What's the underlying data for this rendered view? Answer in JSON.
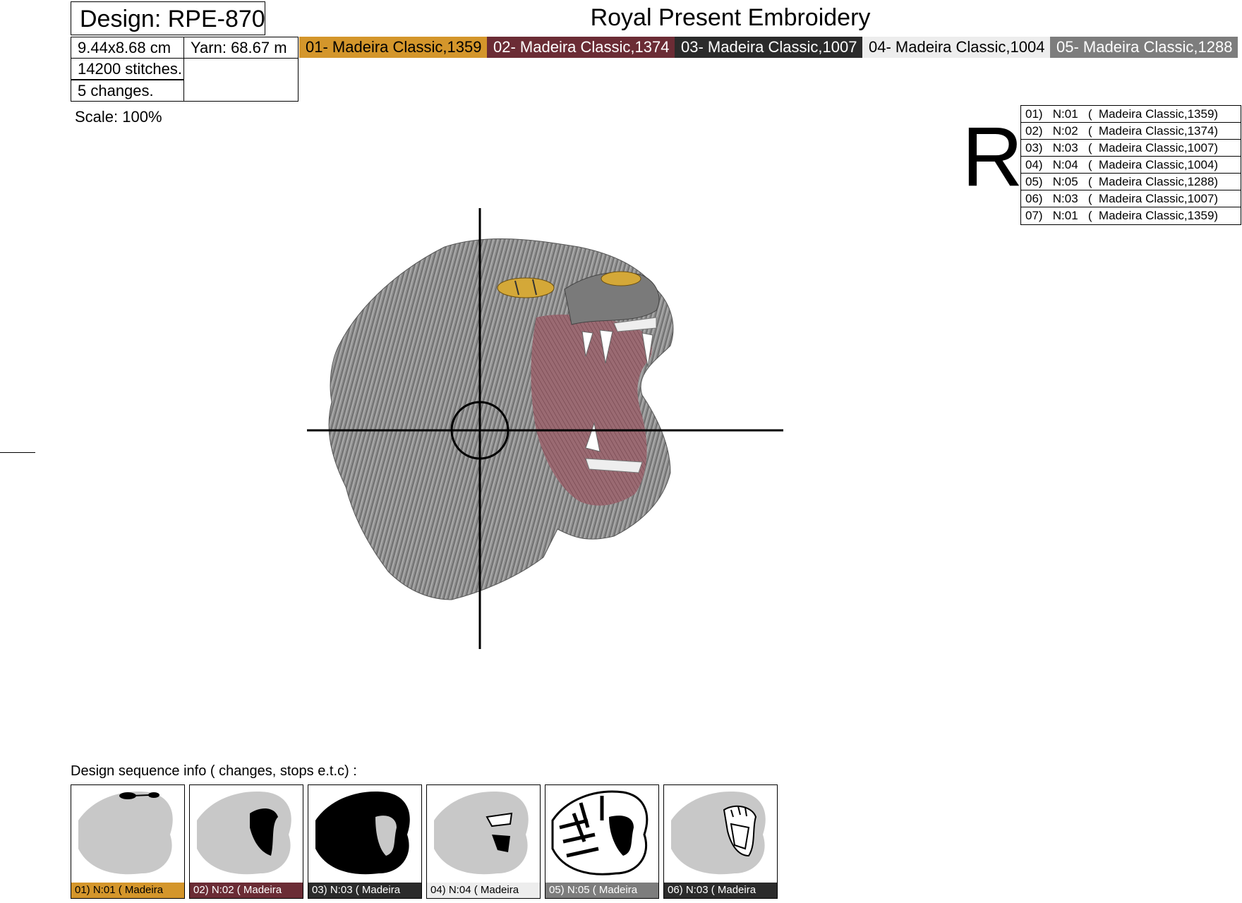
{
  "header": {
    "design_label": "Design: RPE-870",
    "company": "Royal Present Embroidery"
  },
  "stats": {
    "size": "9.44x8.68 cm",
    "yarn": "Yarn: 68.67 m",
    "stitches": "14200 stitches.",
    "changes": "5 changes."
  },
  "threads": [
    {
      "label": "01- Madeira Classic,1359",
      "color": "#d4962b",
      "text_color": "#000000"
    },
    {
      "label": "02- Madeira Classic,1374",
      "color": "#6b2c35",
      "text_color": "#ffffff"
    },
    {
      "label": "03- Madeira Classic,1007",
      "color": "#2b2b2b",
      "text_color": "#ffffff"
    },
    {
      "label": "04- Madeira Classic,1004",
      "color": "#ededed",
      "text_color": "#000000"
    },
    {
      "label": "05- Madeira Classic,1288",
      "color": "#7d7d7d",
      "text_color": "#ffffff"
    }
  ],
  "scale": "Scale: 100%",
  "registration_mark": "R",
  "sequence": [
    "01)   N:01   (  Madeira Classic,1359)",
    "02)   N:02   (  Madeira Classic,1374)",
    "03)   N:03   (  Madeira Classic,1007)",
    "04)   N:04   (  Madeira Classic,1004)",
    "05)   N:05   (  Madeira Classic,1288)",
    "06)   N:03   (  Madeira Classic,1007)",
    "07)   N:01   (  Madeira Classic,1359)"
  ],
  "sequence_heading": "Design sequence info   ( changes, stops e.t.c)   :",
  "thumbnails": [
    {
      "caption": "01)   N:01   ( Madeira",
      "color": "#d4962b",
      "text_color": "#000000"
    },
    {
      "caption": "02)   N:02   ( Madeira",
      "color": "#6b2c35",
      "text_color": "#ffffff"
    },
    {
      "caption": "03)   N:03   ( Madeira",
      "color": "#2b2b2b",
      "text_color": "#ffffff"
    },
    {
      "caption": "04)   N:04   ( Madeira",
      "color": "#ededed",
      "text_color": "#000000"
    },
    {
      "caption": "05)   N:05   ( Madeira",
      "color": "#7d7d7d",
      "text_color": "#ffffff"
    },
    {
      "caption": "06)   N:03   ( Madeira",
      "color": "#2b2b2b",
      "text_color": "#ffffff"
    }
  ]
}
